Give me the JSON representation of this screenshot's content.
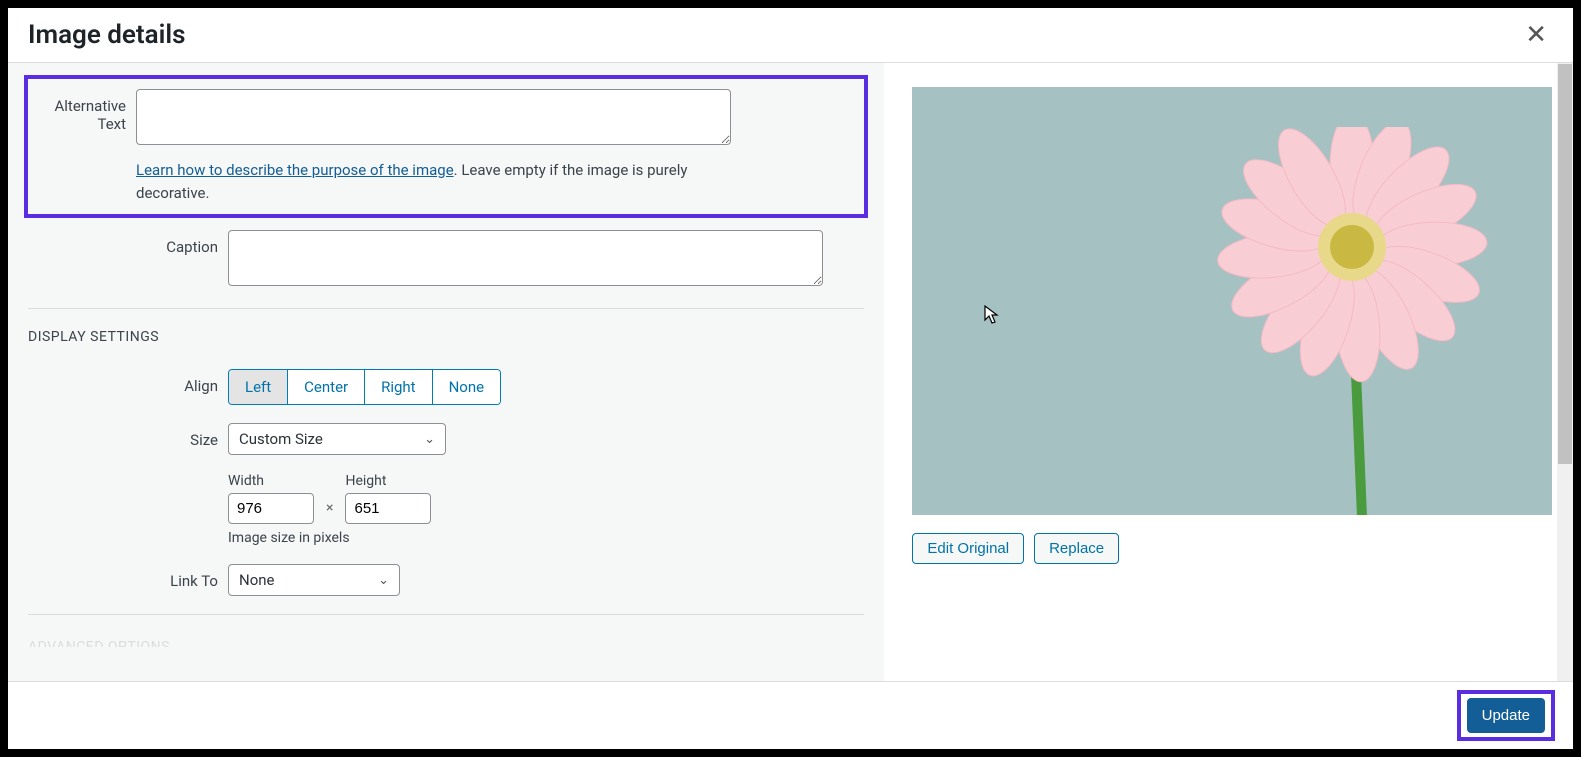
{
  "modal": {
    "title": "Image details",
    "close_glyph": "✕"
  },
  "fields": {
    "alt_label": "Alternative Text",
    "alt_value": "",
    "alt_help_link": "Learn how to describe the purpose of the image",
    "alt_help_tail": ". Leave empty if the image is purely decorative.",
    "caption_label": "Caption",
    "caption_value": ""
  },
  "display": {
    "section_title": "DISPLAY SETTINGS",
    "align_label": "Align",
    "align_options": {
      "left": "Left",
      "center": "Center",
      "right": "Right",
      "none": "None"
    },
    "size_label": "Size",
    "size_value": "Custom Size",
    "width_label": "Width",
    "width_value": "976",
    "dim_sep": "×",
    "height_label": "Height",
    "height_value": "651",
    "dim_hint": "Image size in pixels",
    "linkto_label": "Link To",
    "linkto_value": "None"
  },
  "advanced": {
    "section_title": "ADVANCED OPTIONS"
  },
  "preview": {
    "edit_original": "Edit Original",
    "replace": "Replace"
  },
  "footer": {
    "update": "Update"
  }
}
